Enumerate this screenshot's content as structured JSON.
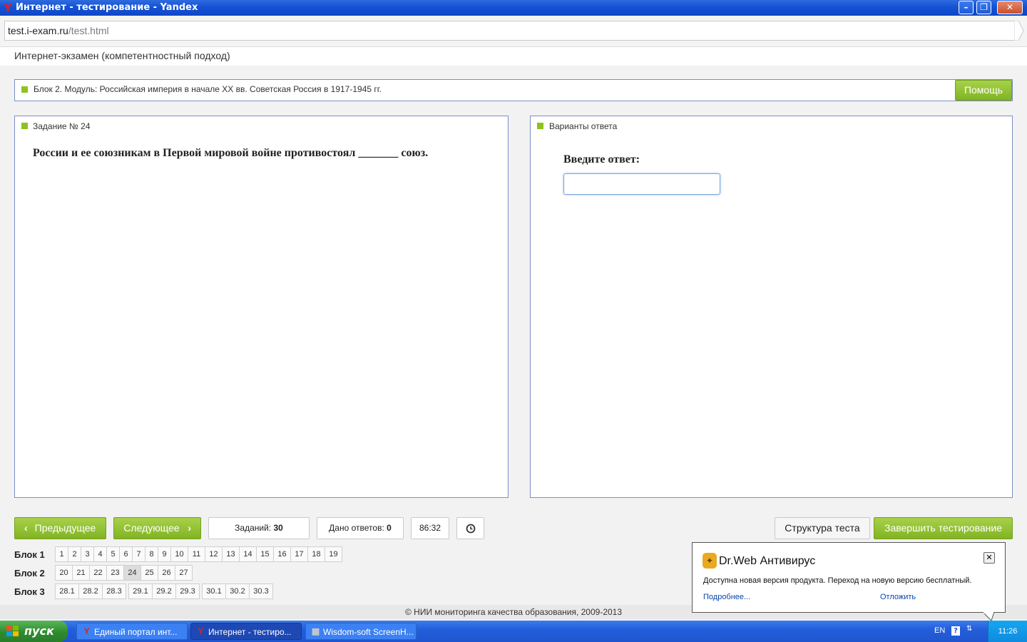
{
  "window": {
    "title": "Интернет - тестирование - Yandex",
    "minimize": "–",
    "maximize": "❐",
    "close": "✕"
  },
  "address": {
    "host": "test.i-exam.ru",
    "path": "/test.html"
  },
  "page": {
    "header": "Интернет-экзамен (компетентностный подход)",
    "block_title": "Блок 2. Модуль: Российская империя в начале ХХ вв. Советская Россия в 1917-1945 гг.",
    "help_label": "Помощь"
  },
  "task": {
    "label": "Задание № 24",
    "question": "России и ее союзникам в Первой мировой войне противостоял _______ союз."
  },
  "answer": {
    "label": "Варианты ответа",
    "prompt": "Введите ответ:",
    "value": ""
  },
  "controls": {
    "prev": "Предыдущее",
    "next": "Следующее",
    "tasks_label": "Заданий:",
    "tasks_count": "30",
    "answered_label": "Дано ответов:",
    "answered_count": "0",
    "timer": "86:32",
    "structure": "Структура теста",
    "finish": "Завершить тестирование"
  },
  "blocks": [
    {
      "label": "Блок 1",
      "items": [
        "1",
        "2",
        "3",
        "4",
        "5",
        "6",
        "7",
        "8",
        "9",
        "10",
        "11",
        "12",
        "13",
        "14",
        "15",
        "16",
        "17",
        "18",
        "19"
      ]
    },
    {
      "label": "Блок 2",
      "items": [
        "20",
        "21",
        "22",
        "23",
        "24",
        "25",
        "26",
        "27"
      ],
      "active": "24"
    },
    {
      "label": "Блок 3",
      "items": [
        "28.1",
        "28.2",
        "28.3",
        "29.1",
        "29.2",
        "29.3",
        "30.1",
        "30.2",
        "30.3"
      ]
    }
  ],
  "footer": "© НИИ мониторинга качества образования, 2009-2013",
  "popup": {
    "title": "Dr.Web Антивирус",
    "text": "Доступна новая версия продукта. Переход на новую версию бесплатный.",
    "more": "Подробнее...",
    "later": "Отложить",
    "close": "✕"
  },
  "taskbar": {
    "start": "пуск",
    "tasks": [
      "Единый портал инт...",
      "Интернет - тестиро...",
      "Wisdom-soft ScreenH..."
    ],
    "lang": "EN",
    "clock": "11:26"
  },
  "colors": {
    "accent_green": "#8dc21f",
    "panel_border": "#7b8fc6",
    "xp_blue": "#245edb"
  }
}
